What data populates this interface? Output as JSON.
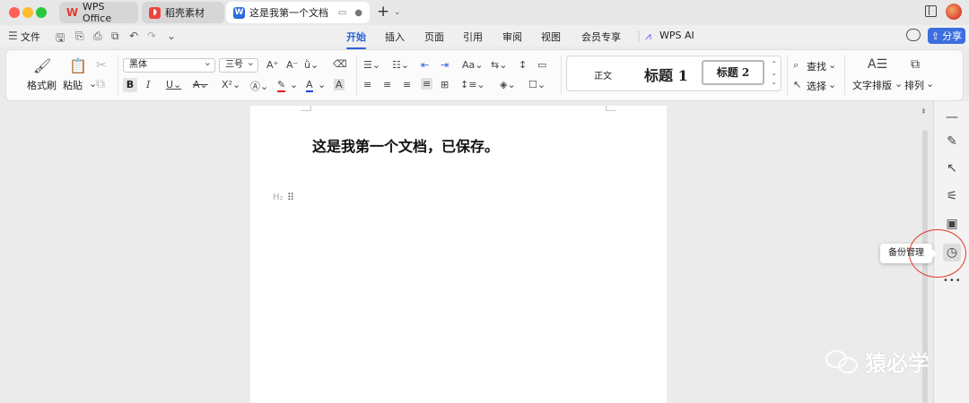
{
  "tabs": [
    {
      "label": "WPS Office"
    },
    {
      "label": "稻壳素材"
    },
    {
      "label": "这是我第一个文档"
    }
  ],
  "menubar": {
    "file_label": "文件",
    "ribbon_tabs": [
      "开始",
      "插入",
      "页面",
      "引用",
      "审阅",
      "视图",
      "会员专享"
    ],
    "wps_ai_label": "WPS AI",
    "share_label": "分享"
  },
  "ribbon": {
    "format_painter": "格式刷",
    "paste": "粘贴",
    "font_name": "黑体",
    "font_size": "三号",
    "style_normal": "正文",
    "style_heading1": "标题 1",
    "style_heading2": "标题 2",
    "find": "查找",
    "select": "选择",
    "text_layout": "文字排版",
    "arrange": "排列"
  },
  "document": {
    "text": "这是我第一个文档，已保存。"
  },
  "right_panel": {
    "tooltip": "备份管理"
  },
  "watermark": {
    "text": "猿必学"
  },
  "colors": {
    "accent": "#2b62d9",
    "share_button": "#3c6ee0",
    "annotation_circle": "#e0392d",
    "font_color_red": "#e02020",
    "font_color_blue": "#1f3fd6"
  }
}
